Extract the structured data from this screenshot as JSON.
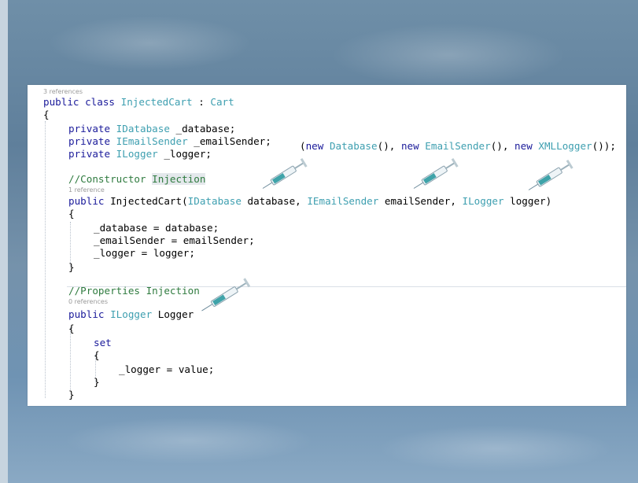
{
  "code": {
    "ref_class": "3 references",
    "class_decl": {
      "kw1": "public",
      "kw2": "class",
      "name": "InjectedCart",
      "sep": " : ",
      "base": "Cart"
    },
    "open_brace": "{",
    "close_brace": "}",
    "fields": [
      {
        "kw": "private",
        "type": "IDatabase",
        "name": " _database;"
      },
      {
        "kw": "private",
        "type": "IEmailSender",
        "name": " _emailSender;"
      },
      {
        "kw": "private",
        "type": "ILogger",
        "name": " _logger;"
      }
    ],
    "new_expr": {
      "open": "(",
      "kw": "new",
      "items": [
        {
          "kw": "new",
          "type": "Database",
          "tail": "(), "
        },
        {
          "kw": "new",
          "type": "EmailSender",
          "tail": "(), "
        },
        {
          "kw": "new",
          "type": "XMLLogger",
          "tail": "());"
        }
      ]
    },
    "ctor_comment": {
      "prefix": "//Constructor ",
      "highlight": "Injection"
    },
    "ref_ctor": "1 reference",
    "ctor_sig": {
      "kw": "public",
      "name": "InjectedCart(",
      "p1_type": "IDatabase",
      "p1_name": " database, ",
      "p2_type": "IEmailSender",
      "p2_name": " emailSender, ",
      "p3_type": "ILogger",
      "p3_name": " logger)"
    },
    "ctor_body": [
      "_database = database;",
      "_emailSender = emailSender;",
      "_logger = logger;"
    ],
    "prop_comment": "//Properties Injection",
    "ref_prop": "0 references",
    "prop_sig": {
      "kw": "public",
      "type": "ILogger",
      "name": "Logger"
    },
    "setter": {
      "kw": "set",
      "body": "_logger = value;"
    }
  },
  "icons": [
    "syringe-icon"
  ]
}
